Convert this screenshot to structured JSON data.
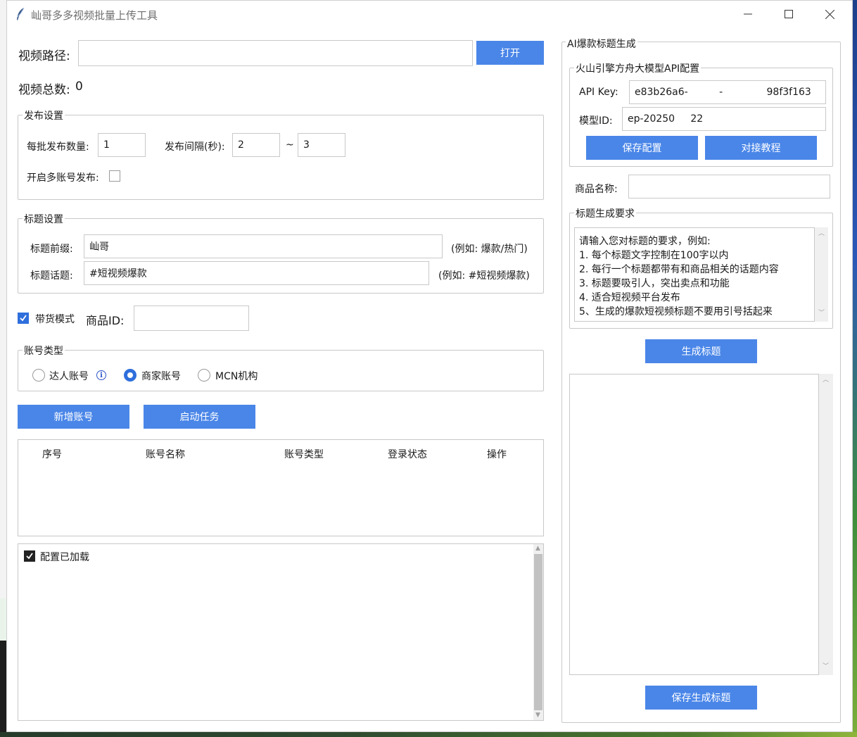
{
  "window": {
    "title": "屾哥多多视频批量上传工具"
  },
  "left": {
    "video_path_label": "视频路径:",
    "video_path_value": "",
    "open_button": "打开",
    "video_count_label": "视频总数:",
    "video_count_value": "0",
    "publish": {
      "legend": "发布设置",
      "batch_label": "每批发布数量:",
      "batch_value": "1",
      "interval_label": "发布间隔(秒):",
      "interval_min": "2",
      "tilde": "~",
      "interval_max": "3",
      "multi_account_label": "开启多账号发布:"
    },
    "title_settings": {
      "legend": "标题设置",
      "prefix_label": "标题前缀:",
      "prefix_value": "屾哥",
      "prefix_hint": "(例如: 爆款/热门)",
      "topic_label": "标题话题:",
      "topic_value": "#短视频爆款",
      "topic_hint": "(例如: #短视频爆款)"
    },
    "goods_mode_label": "带货模式",
    "goods_id_label": "商品ID:",
    "goods_id_value": "",
    "account_type": {
      "legend": "账号类型",
      "options": [
        "达人账号",
        "商家账号",
        "MCN机构"
      ],
      "selected": "商家账号"
    },
    "add_account_button": "新增账号",
    "start_task_button": "启动任务",
    "table": {
      "headers": [
        "序号",
        "账号名称",
        "账号类型",
        "登录状态",
        "操作"
      ],
      "rows": []
    },
    "log": {
      "lines": [
        "配置已加载"
      ]
    }
  },
  "right": {
    "legend": "AI爆款标题生成",
    "api": {
      "legend": "火山引擎方舟大模型API配置",
      "api_key_label": "API Key:",
      "api_key_value": "e83b26a6-          -              98f3f163",
      "model_id_label": "模型ID:",
      "model_id_value": "ep-20250     22",
      "save_config_button": "保存配置",
      "tutorial_button": "对接教程"
    },
    "product_name_label": "商品名称:",
    "product_name_value": "",
    "requirements": {
      "legend": "标题生成要求",
      "lines": [
        "请输入您对标题的要求，例如:",
        "1. 每个标题文字控制在100字以内",
        "2. 每行一个标题都带有和商品相关的话题内容",
        "3. 标题要吸引人，突出卖点和功能",
        "4. 适合短视频平台发布",
        "5、生成的爆款短视频标题不要用引号括起来"
      ]
    },
    "generate_button": "生成标题",
    "output_lines": [],
    "save_titles_button": "保存生成标题"
  }
}
